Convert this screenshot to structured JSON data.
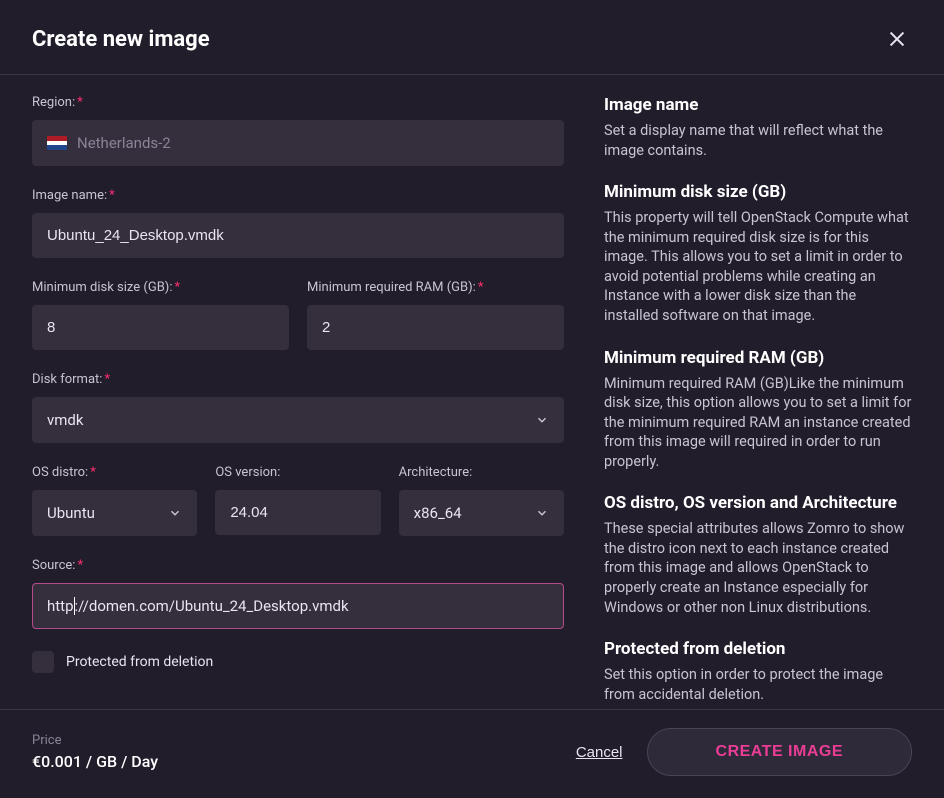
{
  "header": {
    "title": "Create new image"
  },
  "form": {
    "region": {
      "label": "Region:",
      "value": "Netherlands-2"
    },
    "image_name": {
      "label": "Image name:",
      "value": "Ubuntu_24_Desktop.vmdk"
    },
    "min_disk": {
      "label": "Minimum disk size (GB):",
      "value": "8"
    },
    "min_ram": {
      "label": "Minimum required RAM (GB):",
      "value": "2"
    },
    "disk_format": {
      "label": "Disk format:",
      "value": "vmdk"
    },
    "os_distro": {
      "label": "OS distro:",
      "value": "Ubuntu"
    },
    "os_version": {
      "label": "OS version:",
      "value": "24.04"
    },
    "architecture": {
      "label": "Architecture:",
      "value": "x86_64"
    },
    "source": {
      "label": "Source:",
      "value_prefix": "http",
      "value_suffix": "://domen.com/Ubuntu_24_Desktop.vmdk"
    },
    "protected": {
      "label": "Protected from deletion"
    }
  },
  "info": {
    "image_name": {
      "title": "Image name",
      "text": "Set a display name that will reflect what the image contains."
    },
    "min_disk": {
      "title": "Minimum disk size (GB)",
      "text": "This property will tell OpenStack Compute what the minimum required disk size is for this image. This allows you to set a limit in order to avoid potential problems while creating an Instance with a lower disk size than the installed software on that image."
    },
    "min_ram": {
      "title": "Minimum required RAM (GB)",
      "text": "Minimum required RAM (GB)Like the minimum disk size, this option allows you to set a limit for the minimum required RAM an instance created from this image will required in order to run properly."
    },
    "os_attrs": {
      "title": "OS distro, OS version and Architecture",
      "text": "These special attributes allows Zomro to show the distro icon next to each instance created from this image and allows OpenStack to properly create an Instance especially for Windows or other non Linux distributions."
    },
    "protected": {
      "title": "Protected from deletion",
      "text": "Set this option in order to protect the image from accidental deletion."
    }
  },
  "footer": {
    "price_label": "Price",
    "price_value": "€0.001 / GB / Day",
    "cancel": "Cancel",
    "create": "CREATE IMAGE"
  }
}
